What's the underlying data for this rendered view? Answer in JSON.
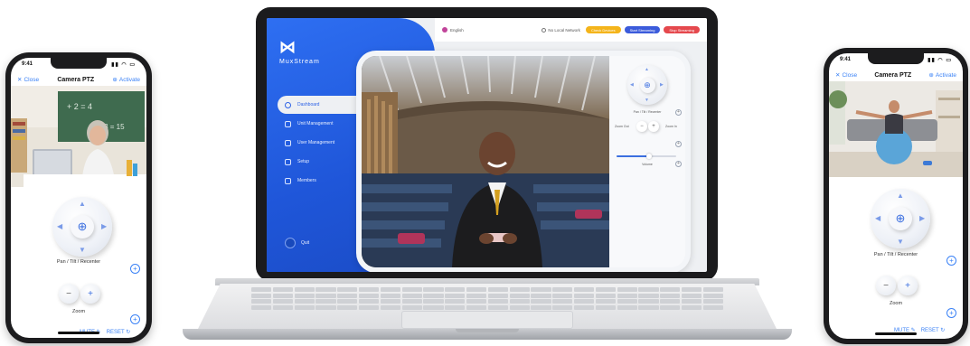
{
  "colors": {
    "brand_blue": "#2e6ff2",
    "accent_blue": "#3b82f6",
    "pill_yellow": "#f4b41a",
    "pill_blue": "#3b5bdb",
    "pill_red": "#e5484d"
  },
  "phone_left": {
    "time": "9:41",
    "nav": {
      "close": "Close",
      "title": "Camera PTZ",
      "activate": "Activate"
    },
    "ptz_label": "Pan / Tilt / Recenter",
    "zoom_label": "Zoom",
    "mute": "MUTE",
    "reset": "RESET"
  },
  "phone_right": {
    "time": "9:41",
    "nav": {
      "close": "Close",
      "title": "Camera PTZ",
      "activate": "Activate"
    },
    "ptz_label": "Pan / Tilt / Recenter",
    "zoom_label": "Zoom",
    "mute": "MUTE",
    "reset": "RESET"
  },
  "laptop": {
    "brand": {
      "name": "MuxStream"
    },
    "menu": [
      {
        "label": "Dashboard",
        "icon": "dashboard-icon",
        "active": true
      },
      {
        "label": "Unit Management",
        "icon": "unit-icon",
        "active": false
      },
      {
        "label": "User Management",
        "icon": "users-icon",
        "active": false
      },
      {
        "label": "Setup",
        "icon": "gear-icon",
        "active": false
      },
      {
        "label": "Members",
        "icon": "person-icon",
        "active": false
      }
    ],
    "quit": "Quit",
    "topbar": {
      "language": "English",
      "network": "No Local Network",
      "buttons": [
        "Check Devices",
        "Start Streaming",
        "Stop Streaming"
      ]
    },
    "controls": {
      "ptz_label": "Pan / Tilt / Recenter",
      "zoom_out": "Zoom Out",
      "zoom_in": "Zoom In",
      "volume_label": "Volume",
      "volume_level": 0.55
    }
  }
}
